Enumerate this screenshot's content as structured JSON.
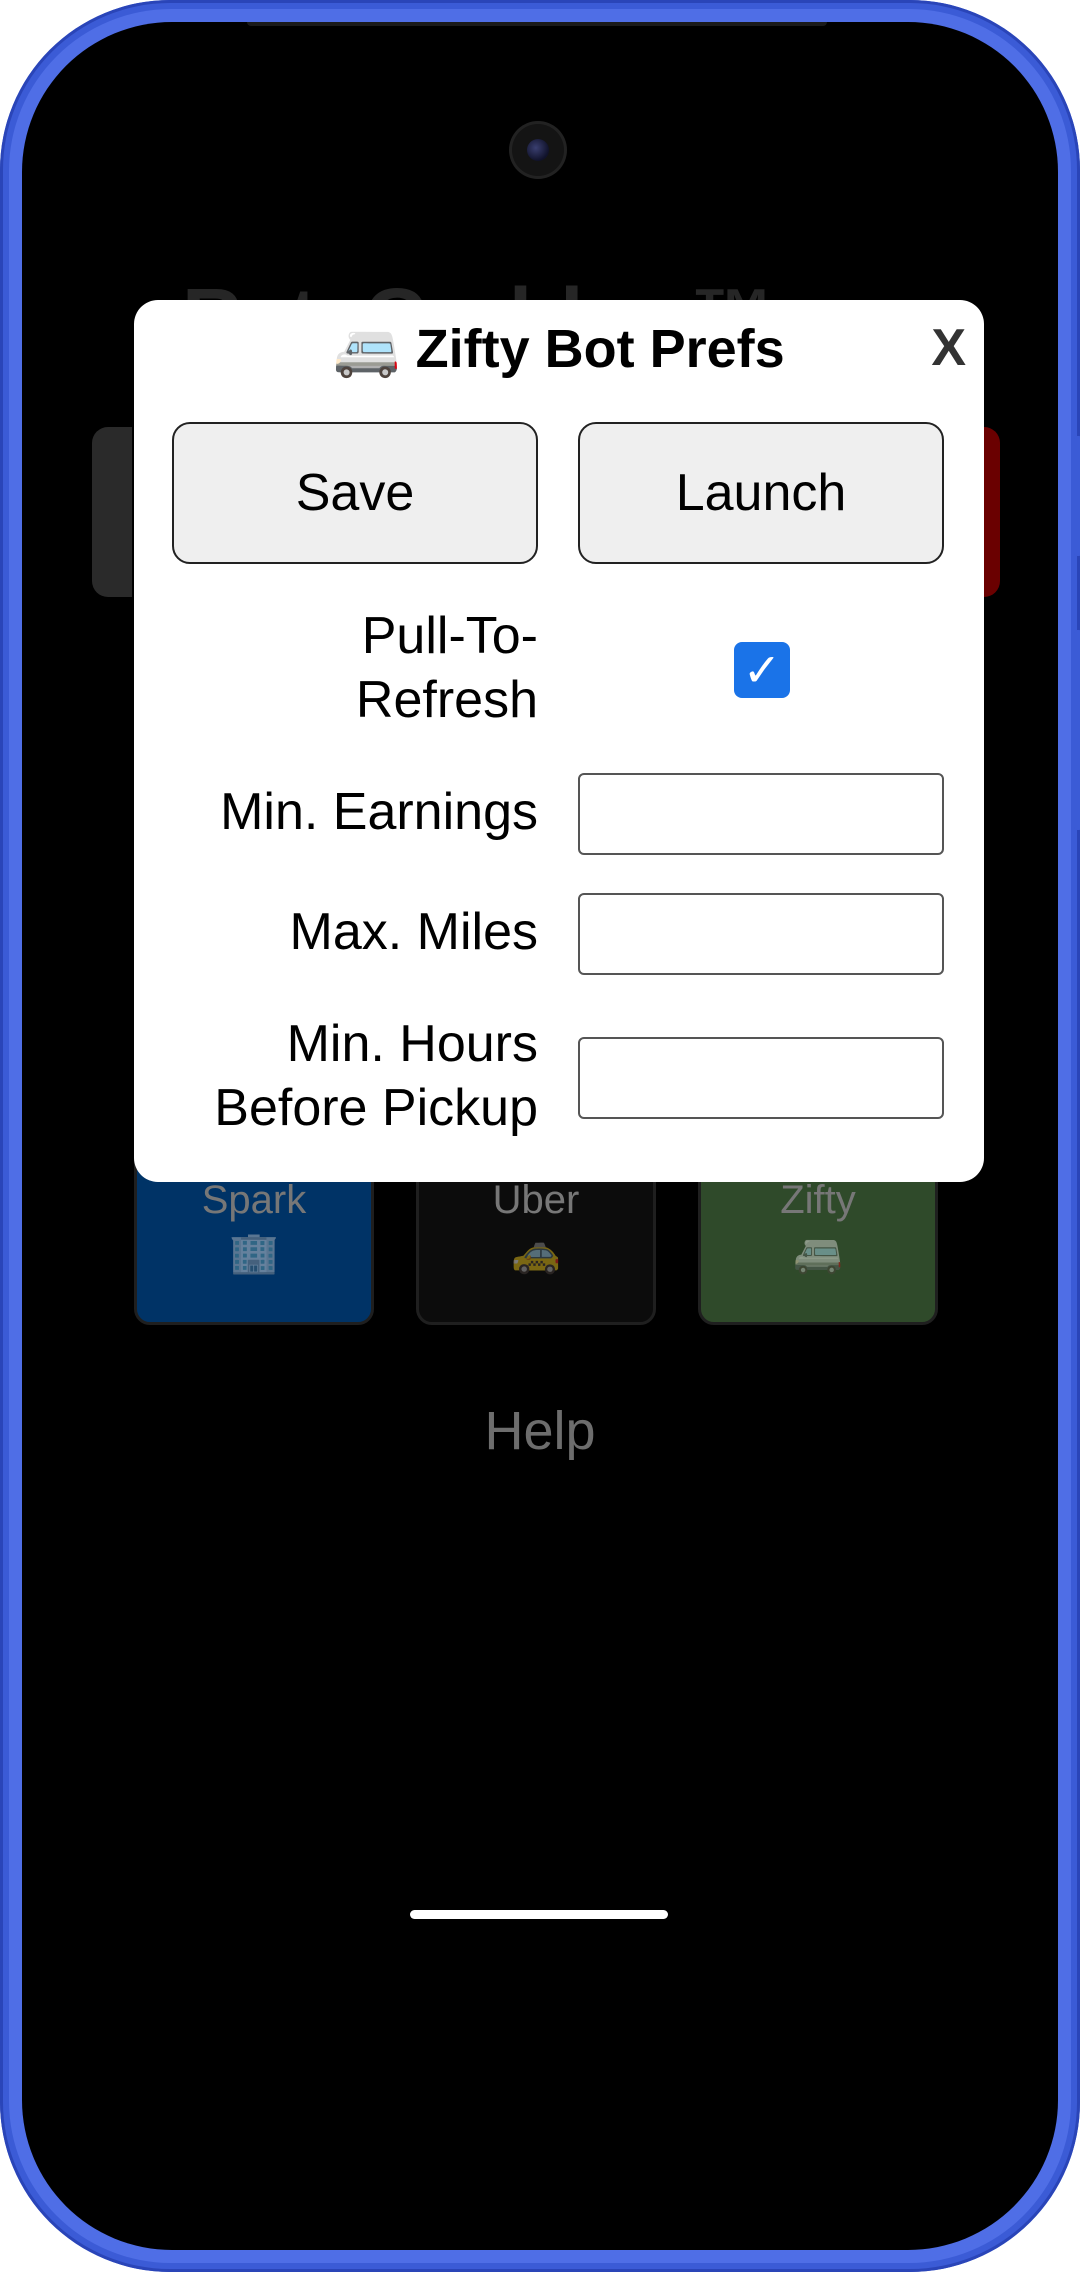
{
  "background_app": {
    "title": "RateGrabber™",
    "tiles": [
      {
        "label": "Spark",
        "icon": "🏢",
        "icon_name": "office-building-icon",
        "color": "#003366"
      },
      {
        "label": "Uber",
        "icon": "🚕",
        "icon_name": "taxi-icon",
        "color": "#0c0c0c"
      },
      {
        "label": "Zifty",
        "icon": "🚐",
        "icon_name": "minibus-icon",
        "color": "#2f4a2a"
      }
    ],
    "help_label": "Help"
  },
  "modal": {
    "icon": "🚐",
    "icon_name": "minibus-icon",
    "title": "Zifty Bot Prefs",
    "close_label": "X",
    "save_label": "Save",
    "launch_label": "Launch",
    "pull_to_refresh": {
      "label_line1": "Pull-To-",
      "label_line2": "Refresh",
      "checked": true,
      "check_glyph": "✓"
    },
    "min_earnings": {
      "label": "Min. Earnings",
      "value": ""
    },
    "max_miles": {
      "label": "Max. Miles",
      "value": ""
    },
    "min_hours": {
      "label_line1": "Min. Hours",
      "label_line2": "Before Pickup",
      "value": ""
    }
  },
  "colors": {
    "frame": "#3b5bd6",
    "checkbox": "#1a73e8"
  }
}
